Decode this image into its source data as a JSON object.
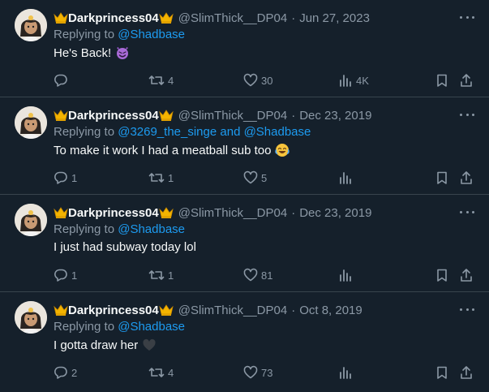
{
  "colors": {
    "background": "#15202b",
    "text_primary": "#f7f9f9",
    "text_secondary": "#8b98a5",
    "link": "#1d9bf0",
    "divider": "#38444d"
  },
  "tweets": [
    {
      "display_name": "Darkprincess04",
      "handle": "@SlimThick__DP04",
      "separator": "·",
      "date": "Jun 27, 2023",
      "replying_prefix": "Replying to ",
      "replying_to": "@Shadbase",
      "text": "He's Back!",
      "emoji": "smiling-imp-emoji",
      "replies": "",
      "retweets": "4",
      "likes": "30",
      "views": "4K"
    },
    {
      "display_name": "Darkprincess04",
      "handle": "@SlimThick__DP04",
      "separator": "·",
      "date": "Dec 23, 2019",
      "replying_prefix": "Replying to ",
      "replying_to": "@3269_the_singe and @Shadbase",
      "text": "To make it work I had a meatball sub too",
      "emoji": "joy-emoji",
      "replies": "1",
      "retweets": "1",
      "likes": "5",
      "views": ""
    },
    {
      "display_name": "Darkprincess04",
      "handle": "@SlimThick__DP04",
      "separator": "·",
      "date": "Dec 23, 2019",
      "replying_prefix": "Replying to ",
      "replying_to": "@Shadbase",
      "text": "I just had subway today lol",
      "emoji": "",
      "replies": "1",
      "retweets": "1",
      "likes": "81",
      "views": ""
    },
    {
      "display_name": "Darkprincess04",
      "handle": "@SlimThick__DP04",
      "separator": "·",
      "date": "Oct 8, 2019",
      "replying_prefix": "Replying to ",
      "replying_to": "@Shadbase",
      "text": "I gotta draw her",
      "emoji": "black-heart-emoji",
      "replies": "2",
      "retweets": "4",
      "likes": "73",
      "views": ""
    }
  ]
}
